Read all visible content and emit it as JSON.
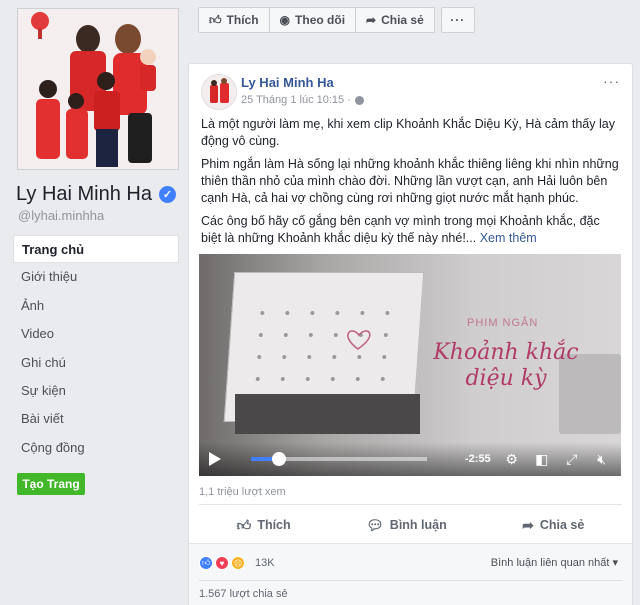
{
  "profile": {
    "name": "Ly Hai Minh Ha",
    "handle": "@lyhai.minhha"
  },
  "nav": {
    "items": [
      {
        "label": "Trang chủ",
        "active": true
      },
      {
        "label": "Giới thiệu"
      },
      {
        "label": "Ảnh"
      },
      {
        "label": "Video"
      },
      {
        "label": "Ghi chú"
      },
      {
        "label": "Sự kiện"
      },
      {
        "label": "Bài viết"
      },
      {
        "label": "Cộng đồng"
      }
    ],
    "create_page": "Tạo Trang"
  },
  "top_bar": {
    "like": "Thích",
    "follow": "Theo dõi",
    "share": "Chia sẻ",
    "more": "···"
  },
  "post": {
    "author": "Ly Hai Minh Ha",
    "time": "25 Tháng 1 lúc 10:15 ·",
    "more": "···",
    "paragraphs": [
      "Là một người làm mẹ, khi xem clip Khoảnh Khắc Diệu Kỳ, Hà cảm thấy lay động vô cùng.",
      "Phim ngắn làm Hà sống lại những khoảnh khắc thiêng liêng khi nhìn những thiên thần nhỏ của mình chào đời. Những lần vượt cạn, anh Hải luôn bên cạnh Hà, cả hai vợ chồng cùng rơi những giọt nước mắt hạnh phúc.",
      "Các ông bố hãy cố gắng bên cạnh vợ mình trong mọi Khoảnh khắc, đặc biệt là những Khoảnh khắc diệu kỳ thế này nhé!..."
    ],
    "see_more": "Xem thêm",
    "video": {
      "brand_sub": "PHIM NGẮN",
      "brand_title": "Khoảnh khắc diệu kỳ",
      "duration": "-2:55",
      "progress": 0.16
    },
    "views": "1,1 triệu lượt xem",
    "actions": {
      "like": "Thích",
      "comment": "Bình luận",
      "share": "Chia sẻ"
    },
    "reaction_count": "13K",
    "sort_label": "Bình luận liên quan nhất ▾",
    "shares": "1.567 lượt chia sẻ"
  },
  "colors": {
    "link": "#365899",
    "accent": "#4080ff",
    "green": "#42b72a",
    "background": "#e9ebee"
  }
}
